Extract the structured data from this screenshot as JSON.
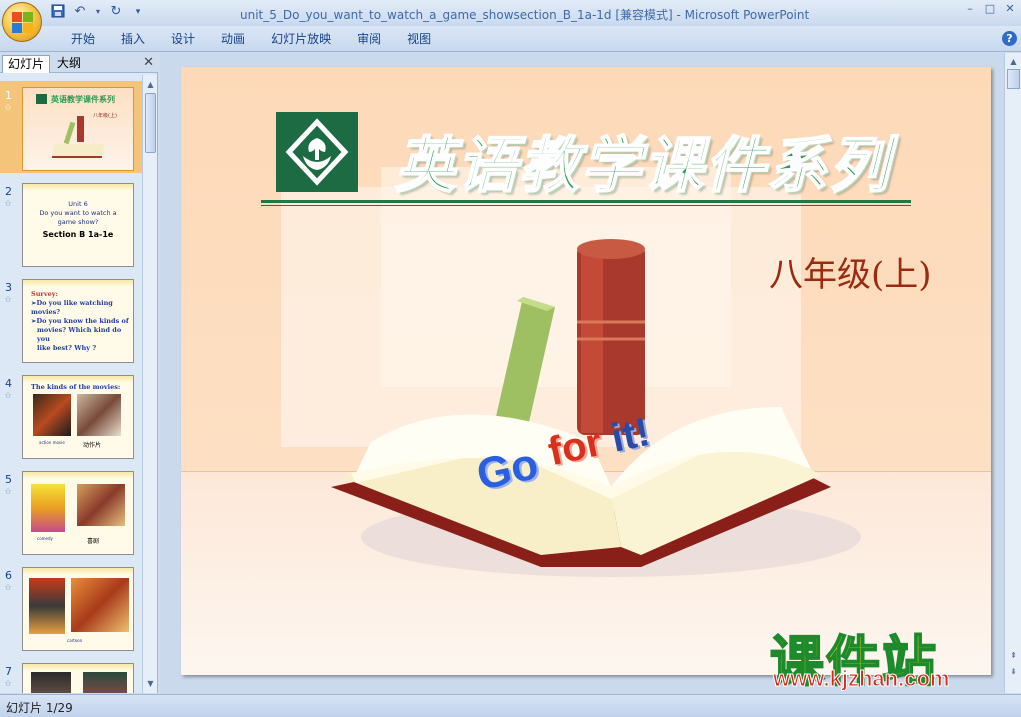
{
  "window": {
    "title": "unit_5_Do_you_want_to_watch_a_game_showsection_B_1a-1d [兼容模式] - Microsoft PowerPoint",
    "controls": [
      "–",
      "□",
      "✕"
    ]
  },
  "ribbon": {
    "tabs": [
      "开始",
      "插入",
      "设计",
      "动画",
      "幻灯片放映",
      "审阅",
      "视图"
    ],
    "help": "?"
  },
  "left_pane": {
    "tab_slides": "幻灯片",
    "tab_outline": "大纲",
    "close": "✕",
    "star": "☆",
    "thumbnails": [
      {
        "num": "1",
        "title": "英语教学课件系列",
        "subtitle": "八年级(上)"
      },
      {
        "num": "2",
        "lines": [
          "Unit 6",
          "Do you want to watch a",
          "game show?",
          "Section B 1a-1e"
        ]
      },
      {
        "num": "3",
        "lines": [
          "Survey:",
          "➢Do you like watching movies?",
          "➢Do you know the kinds of",
          "movies? Which kind do you",
          "like best? Why ?"
        ]
      },
      {
        "num": "4",
        "lines": [
          "The kinds of the movies:",
          "action movie",
          "动作片"
        ]
      },
      {
        "num": "5",
        "lines": [
          "comedy",
          "喜剧"
        ]
      },
      {
        "num": "6",
        "lines": [
          "cartoon"
        ]
      },
      {
        "num": "7",
        "lines": []
      }
    ]
  },
  "slide": {
    "headline": "英语教学课件系列",
    "grade": "八年级(上)",
    "go": "Go",
    "for": "for",
    "it": "it!"
  },
  "watermark": {
    "cn": "课件站",
    "url": "www.kjzhan.com"
  },
  "status": {
    "slide_counter": "幻灯片 1/29"
  },
  "colors": {
    "headline_green": "#2e9a53",
    "logo_green": "#1c6b43",
    "grade_red": "#9a2b10",
    "selection_orange": "#f3c47a"
  }
}
